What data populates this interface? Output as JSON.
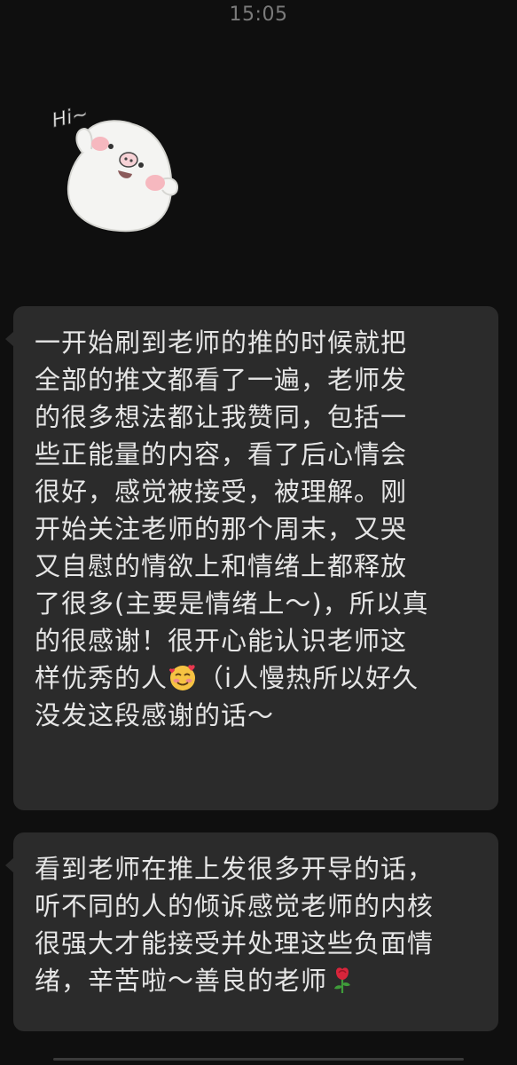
{
  "status": {
    "time": "15:05"
  },
  "sticker": {
    "name": "hi-pig-sticker",
    "text": "Hi~"
  },
  "messages": [
    {
      "lines": [
        "一开始刷到老师的推的时候就把",
        "全部的推文都看了一遍，老师发",
        "的很多想法都让我赞同，包括一",
        "些正能量的内容，看了后心情会",
        "很好，感觉被接受，被理解。刚",
        "开始关注老师的那个周末，又哭",
        "又自慰的情欲上和情绪上都释放",
        "了很多(主要是情绪上～)，所以真",
        "的很感谢！很开心能认识老师这"
      ],
      "line10_before": "样优秀的人",
      "line10_emoji": "smiling-face-with-hearts-icon",
      "line10_after": "（i人慢热所以好久",
      "line11": "没发这段感谢的话～"
    },
    {
      "lines": [
        "看到老师在推上发很多开导的话，",
        "听不同的人的倾诉感觉老师的内核",
        "很强大才能接受并处理这些负面情"
      ],
      "line4_before": "绪，辛苦啦～善良的老师",
      "line4_emoji": "rose-icon"
    }
  ],
  "colors": {
    "background": "#0f0f0f",
    "bubble": "#2b2b2b",
    "text": "#e6e6e6",
    "timestamp": "#7b7b7b"
  }
}
